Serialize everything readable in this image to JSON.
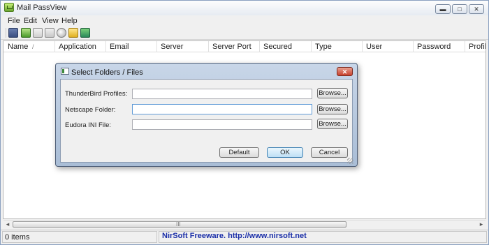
{
  "window": {
    "title": "Mail PassView",
    "minimize_glyph": "▬",
    "maximize_glyph": "□",
    "close_glyph": "✕"
  },
  "menu": [
    "File",
    "Edit",
    "View",
    "Help"
  ],
  "toolbar": {
    "icons": [
      "save-icon",
      "refresh-icon",
      "copy-icon",
      "properties-icon",
      "find-icon",
      "open-folder-icon",
      "exit-icon"
    ]
  },
  "list": {
    "columns": [
      "Name",
      "Application",
      "Email",
      "Server",
      "Server Port",
      "Secured",
      "Type",
      "User",
      "Password",
      "Profile"
    ],
    "sort_indicator": "/"
  },
  "scrollbar": {
    "left_glyph": "◂",
    "right_glyph": "▸",
    "grip_glyph": "III"
  },
  "status": {
    "items": "0 items",
    "link": "NirSoft Freeware.  http://www.nirsoft.net"
  },
  "dialog": {
    "title": "Select Folders / Files",
    "close_glyph": "✕",
    "fields": [
      {
        "label": "ThunderBird Profiles:",
        "value": "",
        "browse": "Browse..."
      },
      {
        "label": "Netscape Folder:",
        "value": "",
        "browse": "Browse..."
      },
      {
        "label": "Eudora INI File:",
        "value": "",
        "browse": "Browse..."
      }
    ],
    "buttons": {
      "default": "Default",
      "ok": "OK",
      "cancel": "Cancel"
    }
  },
  "colors": {
    "title_bar": "#e6ebf2",
    "dialog_frame": "#a9bdd6",
    "status_link": "#1a2ea8",
    "close_button": "#c8402c"
  }
}
